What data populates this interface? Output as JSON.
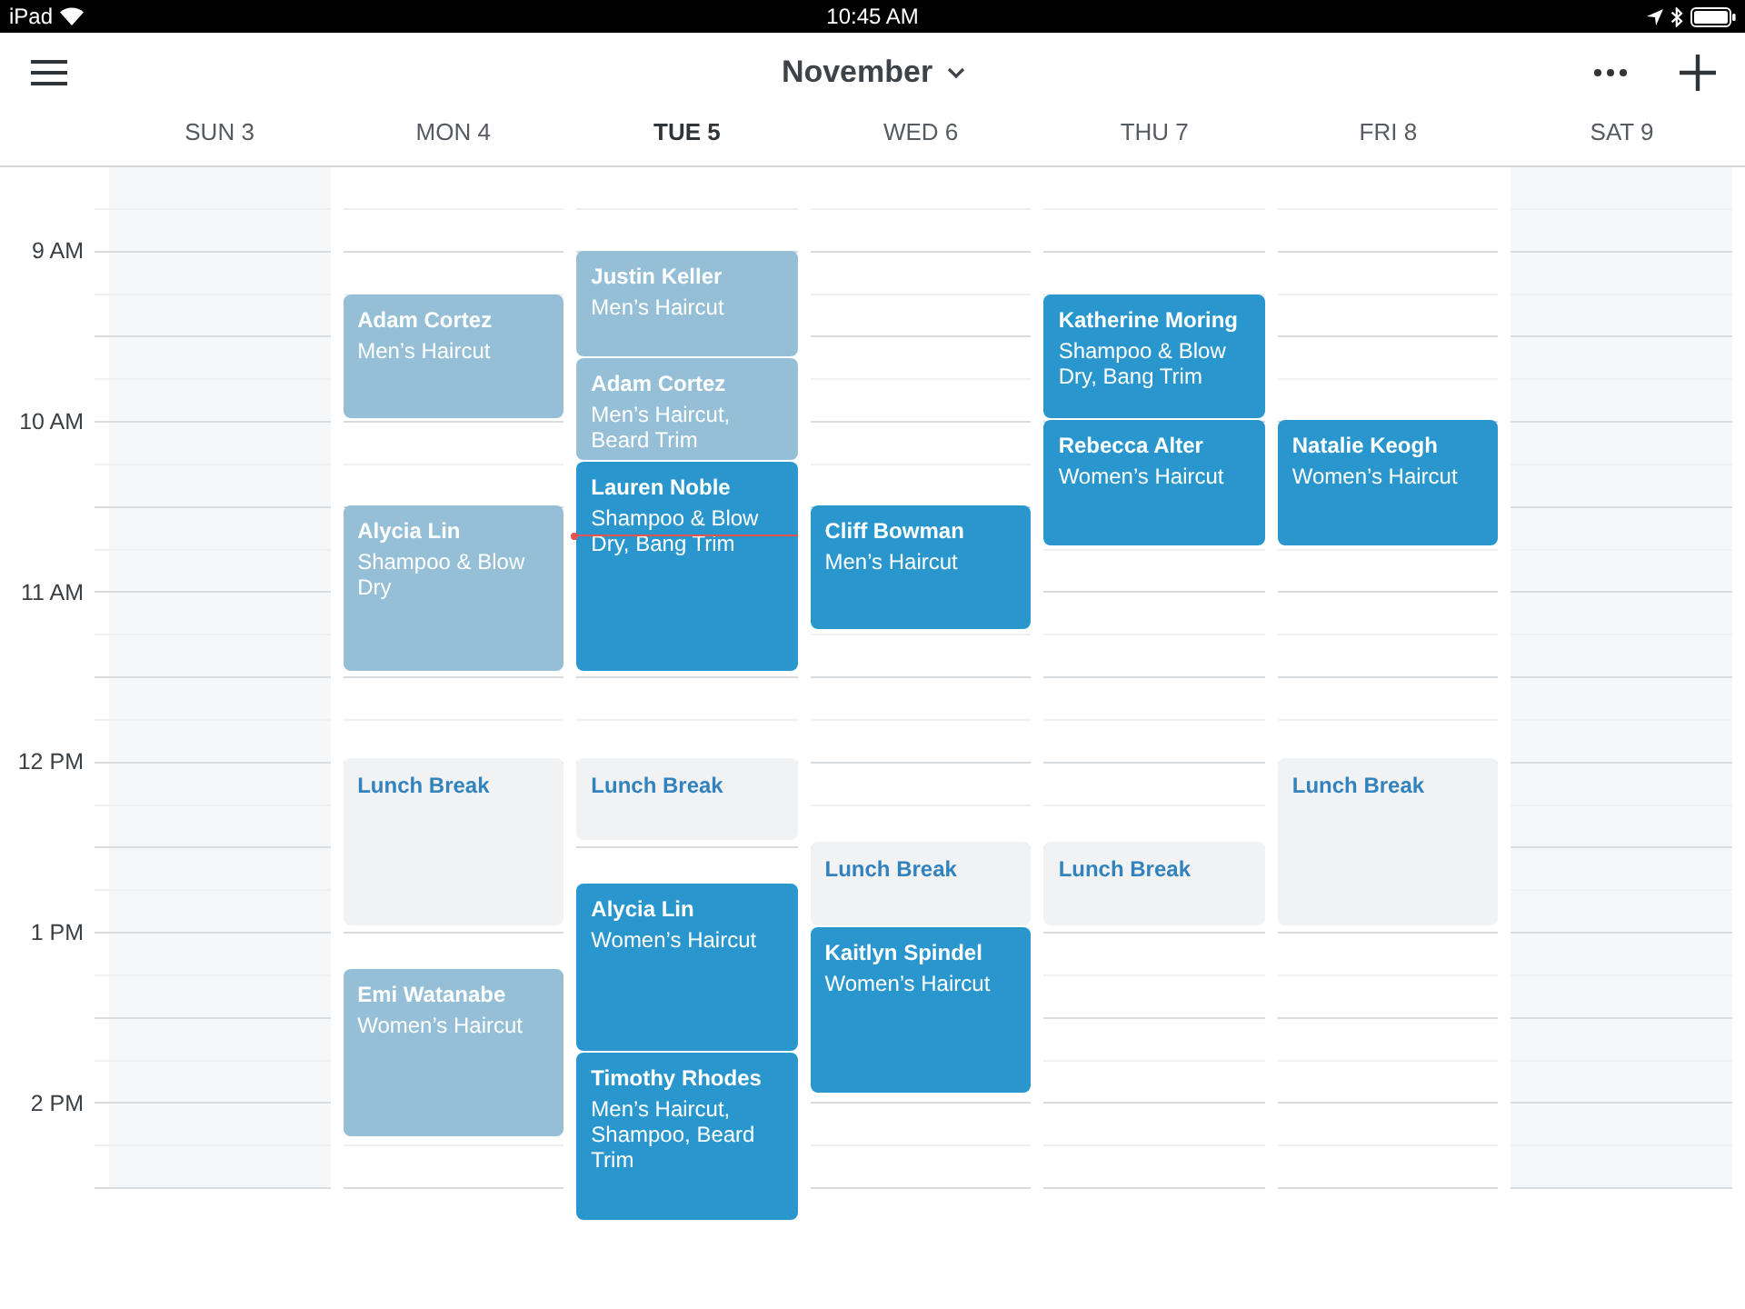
{
  "status_bar": {
    "device": "iPad",
    "clock": "10:45 AM"
  },
  "header": {
    "month": "November"
  },
  "hours": [
    "9 AM",
    "10 AM",
    "11 AM",
    "12 PM",
    "1 PM",
    "2 PM"
  ],
  "days": [
    {
      "label": "SUN 3",
      "today": false,
      "closed": true
    },
    {
      "label": "MON 4",
      "today": false,
      "closed": false,
      "events": [
        {
          "kind": "appointment",
          "client": "Adam Cortez",
          "service": "Men’s Haircut",
          "past": true
        },
        {
          "kind": "appointment",
          "client": "Alycia Lin",
          "service": "Shampoo & Blow Dry",
          "past": true
        },
        {
          "kind": "break",
          "title": "Lunch Break"
        },
        {
          "kind": "appointment",
          "client": "Emi Watanabe",
          "service": "Women’s Haircut",
          "past": true
        }
      ]
    },
    {
      "label": "TUE 5",
      "today": true,
      "closed": false,
      "events": [
        {
          "kind": "appointment",
          "client": "Justin Keller",
          "service": "Men’s Haircut",
          "past": true
        },
        {
          "kind": "appointment",
          "client": "Adam Cortez",
          "service": "Men’s Haircut, Beard Trim",
          "past": true
        },
        {
          "kind": "appointment",
          "client": "Lauren Noble",
          "service": "Shampoo & Blow Dry, Bang Trim",
          "past": false
        },
        {
          "kind": "break",
          "title": "Lunch Break"
        },
        {
          "kind": "appointment",
          "client": "Alycia Lin",
          "service": "Women’s Haircut",
          "past": false
        },
        {
          "kind": "appointment",
          "client": "Timothy Rhodes",
          "service": "Men’s Haircut, Shampoo, Beard Trim",
          "past": false
        }
      ]
    },
    {
      "label": "WED 6",
      "today": false,
      "closed": false,
      "events": [
        {
          "kind": "appointment",
          "client": "Cliff Bowman",
          "service": "Men’s Haircut",
          "past": false
        },
        {
          "kind": "break",
          "title": "Lunch Break"
        },
        {
          "kind": "appointment",
          "client": "Kaitlyn Spindel",
          "service": "Women’s Haircut",
          "past": false
        }
      ]
    },
    {
      "label": "THU 7",
      "today": false,
      "closed": false,
      "events": [
        {
          "kind": "appointment",
          "client": "Katherine Moring",
          "service": "Shampoo & Blow Dry, Bang Trim",
          "past": false
        },
        {
          "kind": "appointment",
          "client": "Rebecca Alter",
          "service": "Women’s Haircut",
          "past": false
        },
        {
          "kind": "break",
          "title": "Lunch Break"
        }
      ]
    },
    {
      "label": "FRI 8",
      "today": false,
      "closed": false,
      "events": [
        {
          "kind": "appointment",
          "client": "Natalie Keogh",
          "service": "Women’s Haircut",
          "past": false
        },
        {
          "kind": "break",
          "title": "Lunch Break"
        }
      ]
    },
    {
      "label": "SAT 9",
      "today": false,
      "closed": true
    }
  ]
}
